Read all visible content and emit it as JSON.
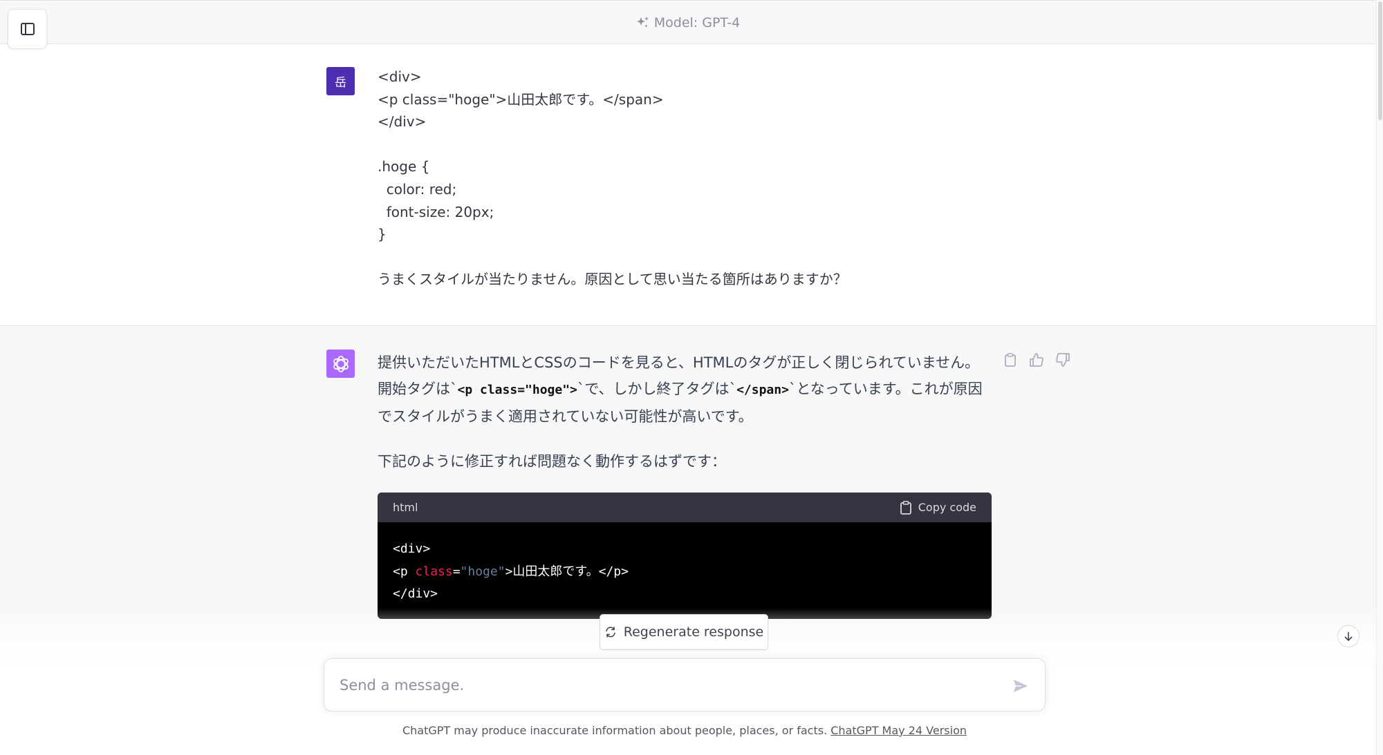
{
  "header": {
    "model_label": "Model: GPT-4"
  },
  "user_message": {
    "avatar_initial": "岳",
    "lines": [
      "<div>",
      "<p class=\"hoge\">山田太郎です。</span>",
      "</div>",
      "",
      ".hoge {",
      "  color: red;",
      "  font-size: 20px;",
      "}",
      "",
      "うまくスタイルが当たりません。原因として思い当たる箇所はありますか？"
    ]
  },
  "assistant_message": {
    "para1_a": "提供いただいたHTMLとCSSのコードを見ると、HTMLのタグが正しく閉じられていません。開始タグは`",
    "para1_code1": "<p class=\"hoge\">",
    "para1_b": "`で、しかし終了タグは`",
    "para1_code2": "</span>",
    "para1_c": "`となっています。これが原因でスタイルがうまく適用されていない可能性が高いです。",
    "para2": "下記のように修正すれば問題なく動作するはずです：",
    "code_block": {
      "language": "html",
      "copy_label": "Copy code",
      "line1": "<div>",
      "line2_open": "<p ",
      "line2_attr": "class",
      "line2_eq": "=",
      "line2_str": "\"hoge\"",
      "line2_rest": ">山田太郎です。</p>",
      "line3": "</div>"
    }
  },
  "regenerate_label": "Regenerate response",
  "composer": {
    "placeholder": "Send a message."
  },
  "footer": {
    "disclaimer": "ChatGPT may produce inaccurate information about people, places, or facts. ",
    "version_link": "ChatGPT May 24 Version"
  },
  "colors": {
    "user_avatar": "#4d2eb0",
    "gpt_avatar": "#ab68ff",
    "code_attr": "#e9225c",
    "code_string": "#6b7ea0"
  }
}
